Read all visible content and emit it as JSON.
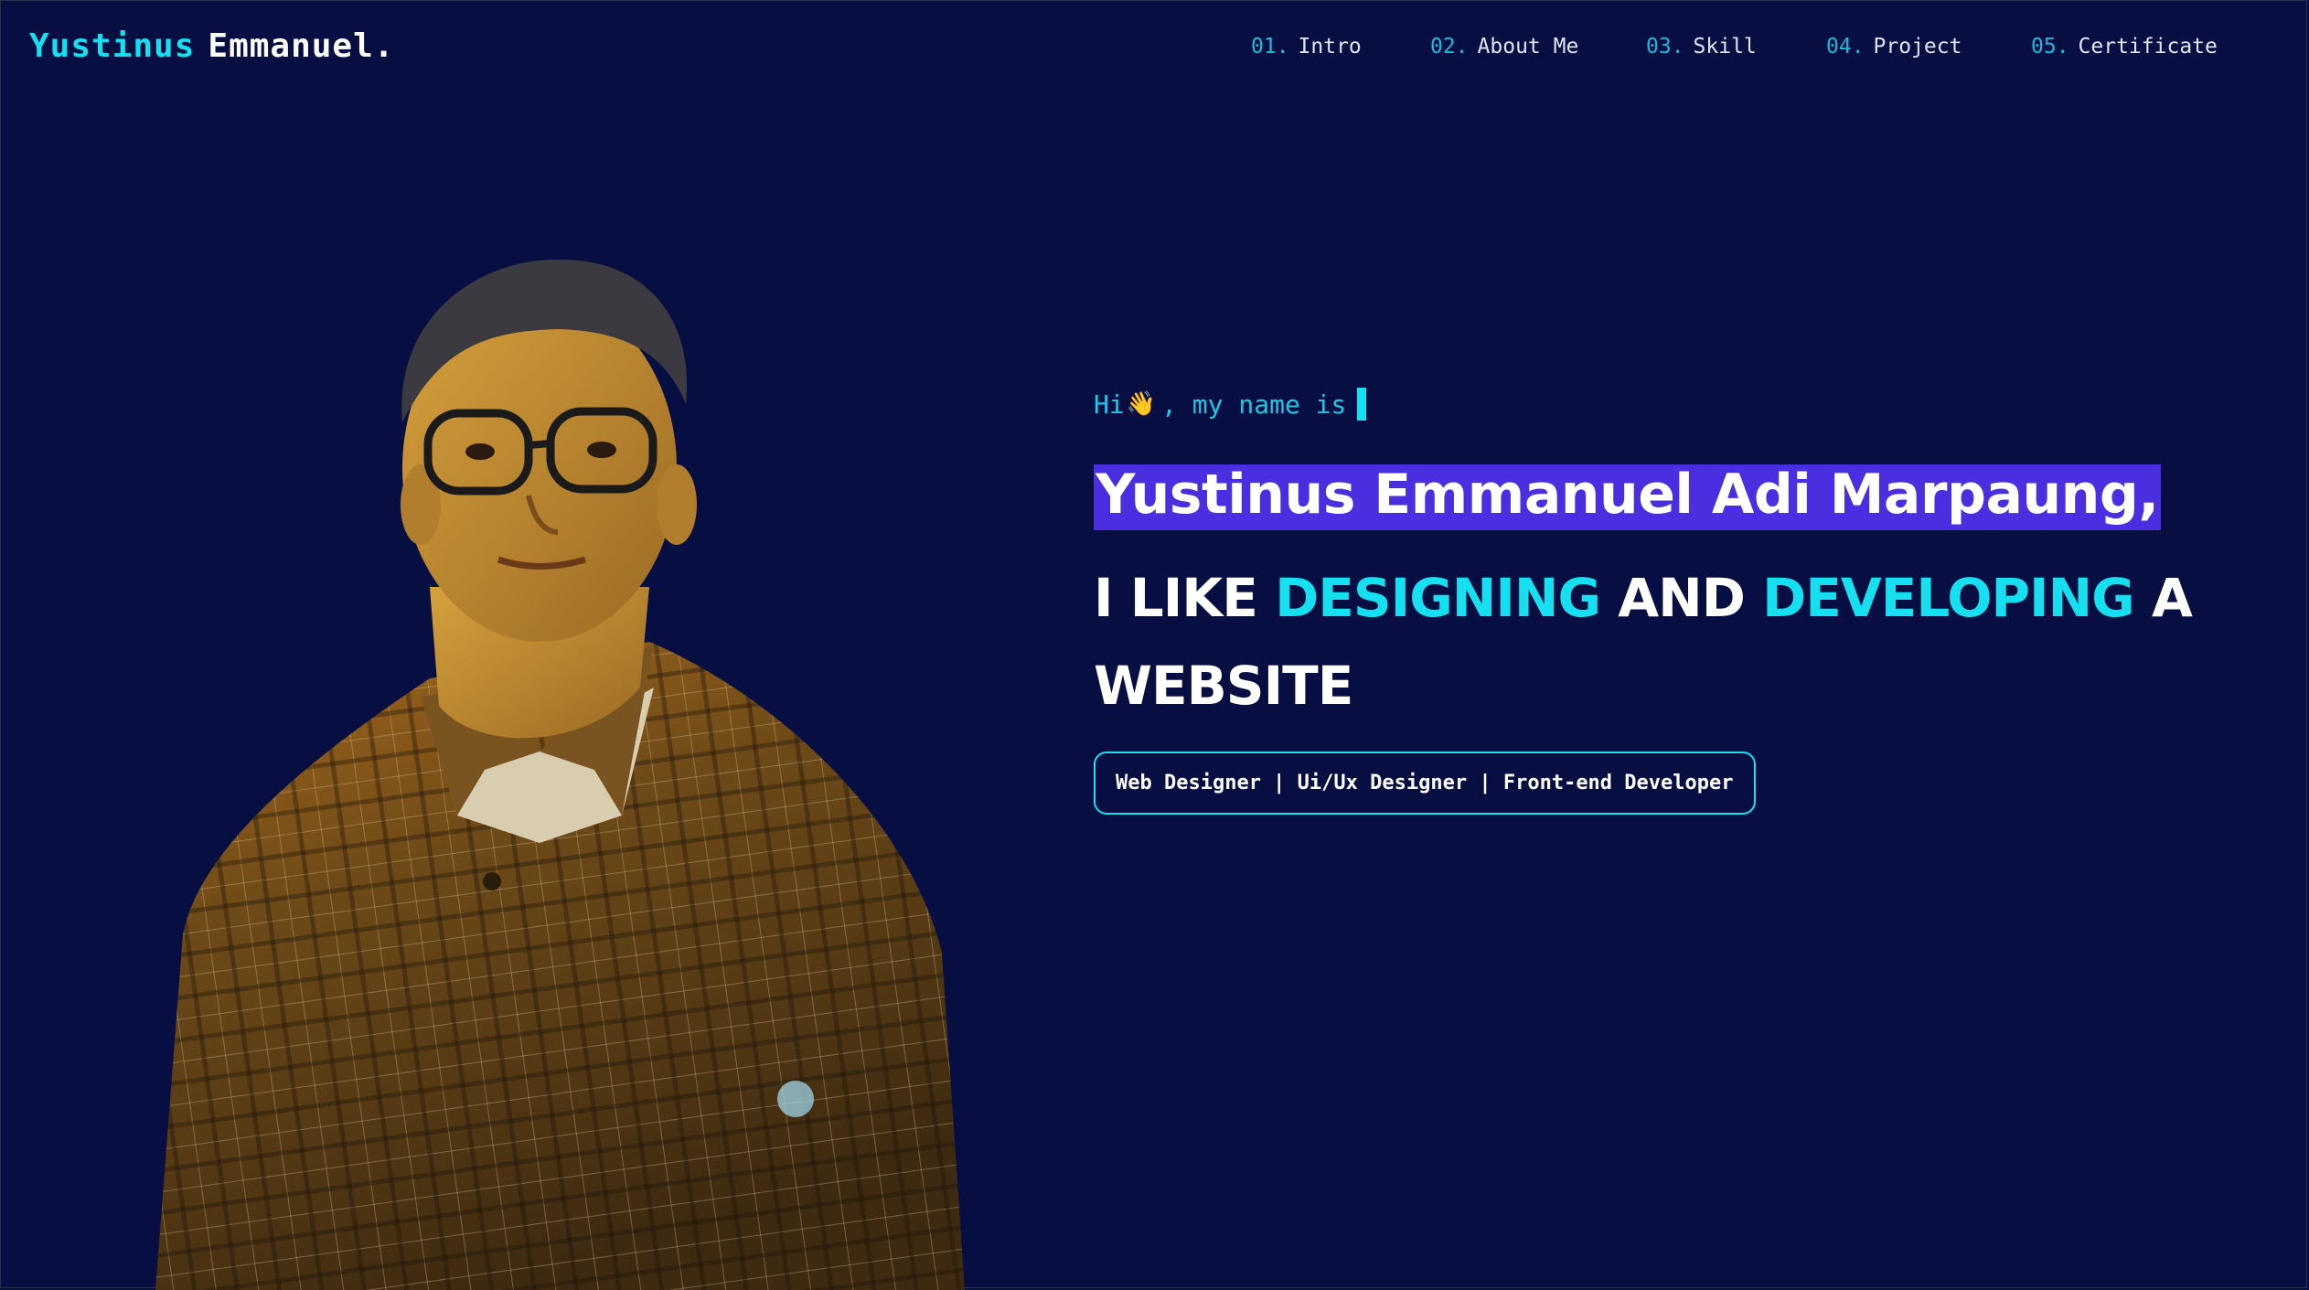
{
  "brand": {
    "first": "Yustinus",
    "last": "Emmanuel."
  },
  "nav": [
    {
      "num": "01.",
      "label": "Intro"
    },
    {
      "num": "02.",
      "label": "About Me"
    },
    {
      "num": "03.",
      "label": "Skill"
    },
    {
      "num": "04.",
      "label": "Project"
    },
    {
      "num": "05.",
      "label": "Certificate"
    }
  ],
  "hero": {
    "greeting_before": "Hi",
    "greeting_after": ", my name is",
    "name": "Yustinus Emmanuel Adi Marpaung,",
    "tagline": {
      "part1": "I LIKE",
      "accent1": "DESIGNING",
      "part2": "AND",
      "accent2": "DEVELOPING",
      "part3": "A WEBSITE"
    },
    "roles": "Web Designer | Ui/Ux Designer | Front-end Developer"
  },
  "icons": {
    "wave": "waving-hand-icon"
  },
  "colors": {
    "background": "#070f42",
    "accent": "#16e0f0",
    "highlight": "#4a2ee0",
    "nav_number": "#1fb8d8"
  }
}
